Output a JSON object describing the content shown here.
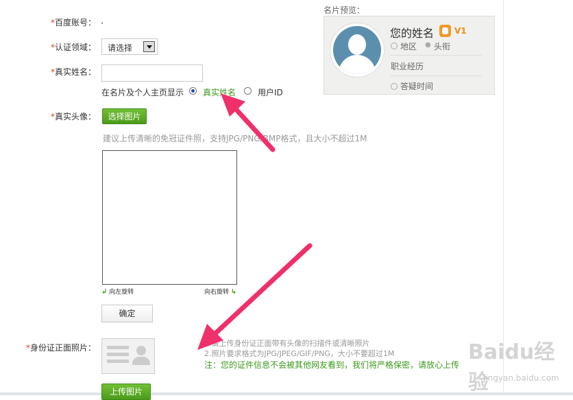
{
  "form": {
    "account": {
      "label": "百度账号：",
      "value": "،"
    },
    "field": {
      "label": "认证领域：",
      "selected": "请选择"
    },
    "realname": {
      "label": "真实姓名：",
      "value": "",
      "display_prefix": "在名片及个人主页显示",
      "option_realname": "真实姓名",
      "option_userid": "用户ID",
      "selected": "真实姓名"
    },
    "portrait": {
      "label": "真实头像：",
      "choose_button": "选择图片",
      "hint": "建议上传清晰的免冠证件照，支持JPG/PNG/BMP格式，且大小不超过1M",
      "rotate_left": "向左旋转",
      "rotate_right": "向右旋转",
      "confirm_button": "确定"
    },
    "idcard": {
      "label": "身份证正面照片：",
      "note1": "1.请上传身份证正面带有头像的扫描件或清晰照片",
      "note2": "2.照片要求格式为JPG/JPEG/GIF/PNG，大小不要超过1M",
      "note3": "注：您的证件信息不会被其他网友看到，我们将严格保密，请放心上传",
      "upload_button": "上传图片"
    },
    "required_mark": "*"
  },
  "preview": {
    "title": "名片预览：",
    "name": "您的姓名",
    "level": "V1",
    "region": "地区",
    "role": "头衔",
    "career": "职业经历",
    "answer_time": "答疑时间"
  },
  "watermark": {
    "brand": "Baidu经验",
    "url": "jingyan.baidu.com"
  },
  "colors": {
    "accent_green": "#4c9b1c",
    "required_red": "#e0401a",
    "arrow_pink": "#f0306a"
  }
}
